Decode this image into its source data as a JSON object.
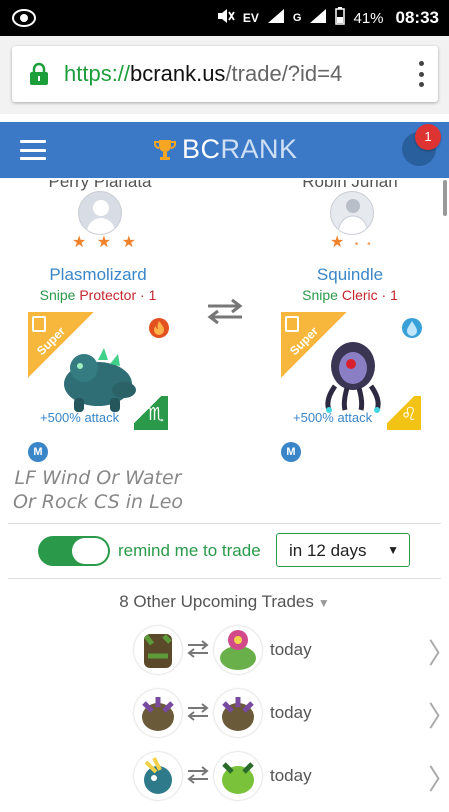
{
  "status_bar": {
    "network_left": "G",
    "network_right": "EV",
    "battery": "41%",
    "time": "08:33"
  },
  "browser": {
    "url_scheme": "https://",
    "url_host": "bcrank.us",
    "url_path": "/trade/?id=4"
  },
  "app": {
    "brand_part1": "BC",
    "brand_part2": "RANK",
    "notification_count": "1"
  },
  "trade": {
    "left": {
      "user_name": "Perry Planata",
      "stars": "★ ★ ★",
      "monster_name": "Plasmolizard",
      "tag_snipe": "Snipe",
      "tag_role": "Protector · 1",
      "ribbon": "Super",
      "attack": "+500% attack",
      "sign": "♏",
      "m_badge": "M",
      "element": "fire"
    },
    "right": {
      "user_name": "Robin Jurian",
      "stars": "★",
      "stars_dim": "• •",
      "monster_name": "Squindle",
      "tag_snipe": "Snipe",
      "tag_role": "Cleric · 1",
      "ribbon": "Super",
      "attack": "+500% attack",
      "sign": "♌",
      "m_badge": "M",
      "element": "water"
    },
    "note": "LF Wind Or Water Or Rock CS in Leo"
  },
  "remind": {
    "label": "remind me to trade",
    "select_value": "in 12 days",
    "toggle_on": true
  },
  "upcoming": {
    "title": "8 Other Upcoming Trades",
    "rows": [
      {
        "when": "today"
      },
      {
        "when": "today"
      },
      {
        "when": "today"
      }
    ]
  },
  "colors": {
    "appbar": "#3b79c7",
    "green": "#2a9a4a",
    "blue_text": "#3a86c8",
    "red_text": "#c4262e",
    "star": "#f0822b"
  }
}
